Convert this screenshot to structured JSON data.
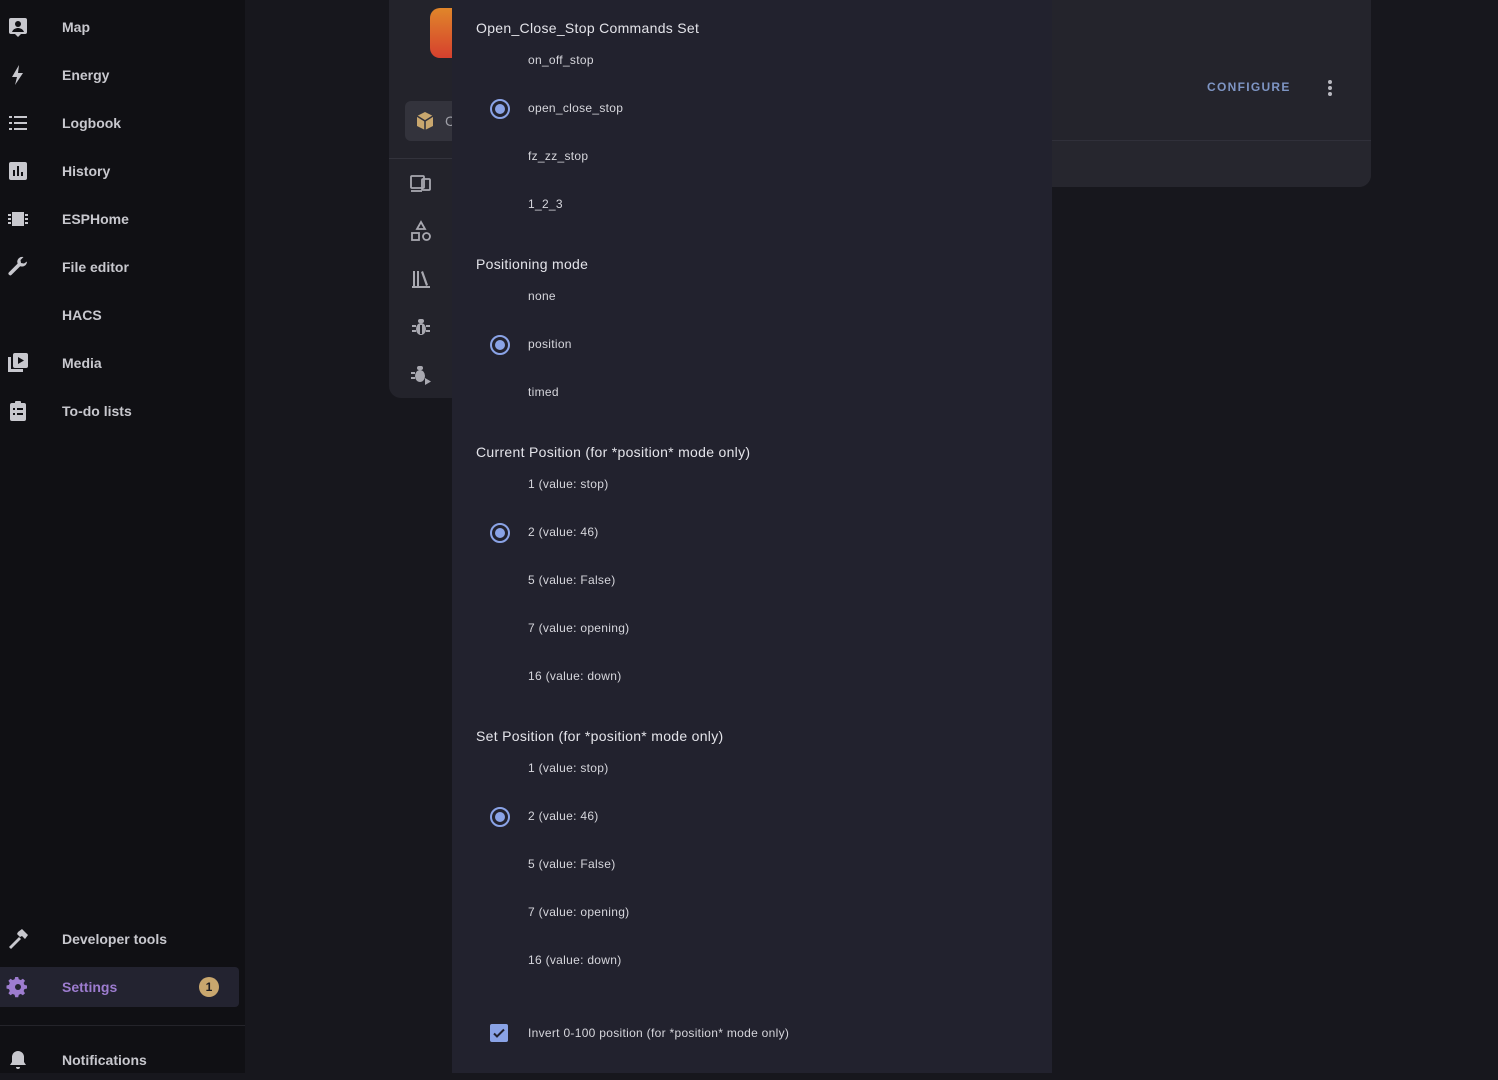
{
  "sidebar": {
    "items": [
      {
        "name": "map",
        "label": "Map",
        "icon": "map-icon"
      },
      {
        "name": "energy",
        "label": "Energy",
        "icon": "lightning-icon"
      },
      {
        "name": "logbook",
        "label": "Logbook",
        "icon": "list-icon"
      },
      {
        "name": "history",
        "label": "History",
        "icon": "bar-chart-icon"
      },
      {
        "name": "esphome",
        "label": "ESPHome",
        "icon": "chip-icon"
      },
      {
        "name": "file-editor",
        "label": "File editor",
        "icon": "wrench-icon"
      },
      {
        "name": "hacs",
        "label": "HACS",
        "icon": ""
      },
      {
        "name": "media",
        "label": "Media",
        "icon": "play-box-icon"
      },
      {
        "name": "todo",
        "label": "To-do lists",
        "icon": "clipboard-list-icon"
      }
    ],
    "developer_tools": "Developer tools",
    "settings": {
      "label": "Settings",
      "badge": "1"
    },
    "notifications": "Notifications"
  },
  "background_card": {
    "configure_label": "CONFIGURE",
    "selected_tab_peek": "C"
  },
  "dialog": {
    "commands_set": {
      "title": "Open_Close_Stop Commands Set",
      "options": [
        "on_off_stop",
        "open_close_stop",
        "fz_zz_stop",
        "1_2_3"
      ],
      "selected": "open_close_stop"
    },
    "positioning_mode": {
      "title": "Positioning mode",
      "options": [
        "none",
        "position",
        "timed"
      ],
      "selected": "position"
    },
    "current_position": {
      "title": "Current Position (for *position* mode only)",
      "options": [
        "1 (value: stop)",
        "2 (value: 46)",
        "5 (value: False)",
        "7 (value: opening)",
        "16 (value: down)"
      ],
      "selected": "2 (value: 46)"
    },
    "set_position": {
      "title": "Set Position (for *position* mode only)",
      "options": [
        "1 (value: stop)",
        "2 (value: 46)",
        "5 (value: False)",
        "7 (value: opening)",
        "16 (value: down)"
      ],
      "selected": "2 (value: 46)"
    },
    "invert": {
      "label": "Invert 0-100 position (for *position* mode only)",
      "checked": true
    }
  },
  "colors": {
    "accent": "#8aa3e6",
    "settings_active": "#9d7ccf",
    "badge": "#c9a76e"
  }
}
